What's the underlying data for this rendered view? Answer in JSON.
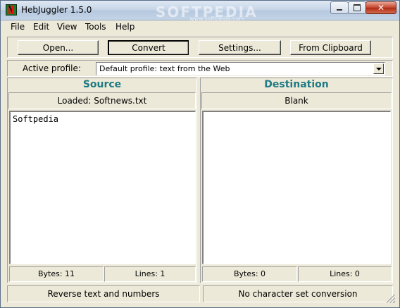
{
  "window": {
    "title": "HebJuggler 1.5.0",
    "watermark": "SOFTPEDIA",
    "watermark_sub": "www.softpedia.com"
  },
  "titlebar_buttons": {
    "close_glyph": "✕"
  },
  "menu": [
    "File",
    "Edit",
    "View",
    "Tools",
    "Help"
  ],
  "toolbar": {
    "open_label": "Open...",
    "convert_label": "Convert",
    "settings_label": "Settings...",
    "clipboard_label": "From Clipboard"
  },
  "profile": {
    "label": "Active profile:",
    "selected": "Default profile: text from the Web"
  },
  "source": {
    "heading": "Source",
    "status": "Loaded: Softnews.txt",
    "text": "Softpedia",
    "bytes": "Bytes: 11",
    "lines": "Lines: 1"
  },
  "destination": {
    "heading": "Destination",
    "status": "Blank",
    "text": "",
    "bytes": "Bytes: 0",
    "lines": "Lines: 0"
  },
  "statusbar": {
    "left": "Reverse text and numbers",
    "right": "No character set conversion"
  },
  "colors": {
    "heading": "#1e7a84",
    "face": "#ece9d8"
  },
  "icons": [
    "app-icon",
    "minimize-icon",
    "maximize-icon",
    "close-icon",
    "dropdown-arrow-icon",
    "resize-grip-icon"
  ]
}
